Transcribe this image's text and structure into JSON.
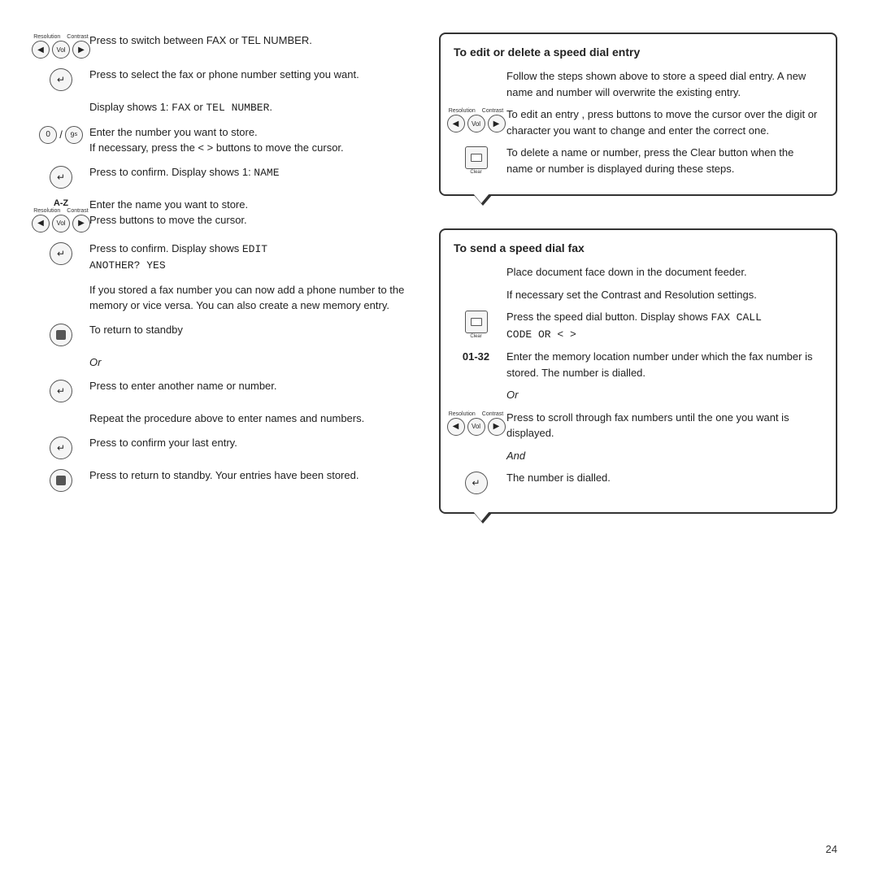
{
  "page": {
    "number": "24"
  },
  "left": {
    "rows": [
      {
        "icon_type": "nav",
        "text": "Press to switch between FAX or TEL NUMBER.",
        "monospace_parts": [
          "FAX",
          "TEL NUMBER"
        ]
      },
      {
        "icon_type": "confirm",
        "text": "Press to select the fax or phone number setting you want."
      },
      {
        "icon_type": "none",
        "text": "Display shows 1: FAX or TEL NUMBER.",
        "has_monospace": true
      },
      {
        "icon_type": "numpad",
        "text": "Enter the number you want to store.",
        "subtext": "If necessary, press the < > buttons to move the cursor."
      },
      {
        "icon_type": "confirm",
        "text": "Press to confirm. Display shows 1: NAME",
        "has_monospace": true
      },
      {
        "icon_type": "az_nav",
        "text": "Enter the name you want to store.",
        "subtext": "Press buttons to move the cursor."
      },
      {
        "icon_type": "confirm",
        "text": "Press to confirm. Display shows EDIT ANOTHER? YES",
        "has_monospace": true
      },
      {
        "icon_type": "none",
        "text": "If you stored a fax number you can now add a phone number to the memory or vice versa. You can also create a new memory entry."
      },
      {
        "icon_type": "stop",
        "text": "To return to standby"
      },
      {
        "icon_type": "none",
        "text": "Or",
        "italic": true
      },
      {
        "icon_type": "confirm",
        "text": "Press to enter another name or number."
      },
      {
        "icon_type": "none",
        "text": "Repeat the procedure above to enter names and numbers."
      },
      {
        "icon_type": "confirm",
        "text": "Press to confirm your last entry."
      },
      {
        "icon_type": "stop",
        "text": "Press to return to standby. Your entries have been stored."
      }
    ]
  },
  "right": {
    "sections": [
      {
        "id": "edit-delete",
        "title": "To edit or delete a speed dial entry",
        "rows": [
          {
            "icon_type": "none",
            "text": "Follow the steps shown above to store a speed dial entry. A new name and number will overwrite the existing entry."
          },
          {
            "icon_type": "nav",
            "text": "To edit an entry , press buttons to move the cursor over the digit or character you want to change and enter the correct one."
          },
          {
            "icon_type": "clear",
            "text": "To delete a name or number, press the Clear button when the name or number is displayed during these steps."
          }
        ]
      },
      {
        "id": "send-speed-dial",
        "title": "To send a speed dial fax",
        "rows": [
          {
            "icon_type": "none",
            "text": "Place document face down in the document feeder."
          },
          {
            "icon_type": "none",
            "text": "If necessary set the Contrast and Resolution settings."
          },
          {
            "icon_type": "clear",
            "text": "Press the speed dial button. Display shows FAX CALL\nCODE OR < >",
            "has_monospace": true
          },
          {
            "icon_type": "label_0132",
            "text": "Enter the memory location number under which the fax number is stored. The number is dialled."
          },
          {
            "icon_type": "none",
            "text": "Or",
            "italic": true
          },
          {
            "icon_type": "nav",
            "text": "Press to scroll through fax numbers until the one you want is displayed."
          },
          {
            "icon_type": "none",
            "text": "And",
            "italic": true
          },
          {
            "icon_type": "confirm",
            "text": "The number is dialled."
          }
        ]
      }
    ]
  }
}
